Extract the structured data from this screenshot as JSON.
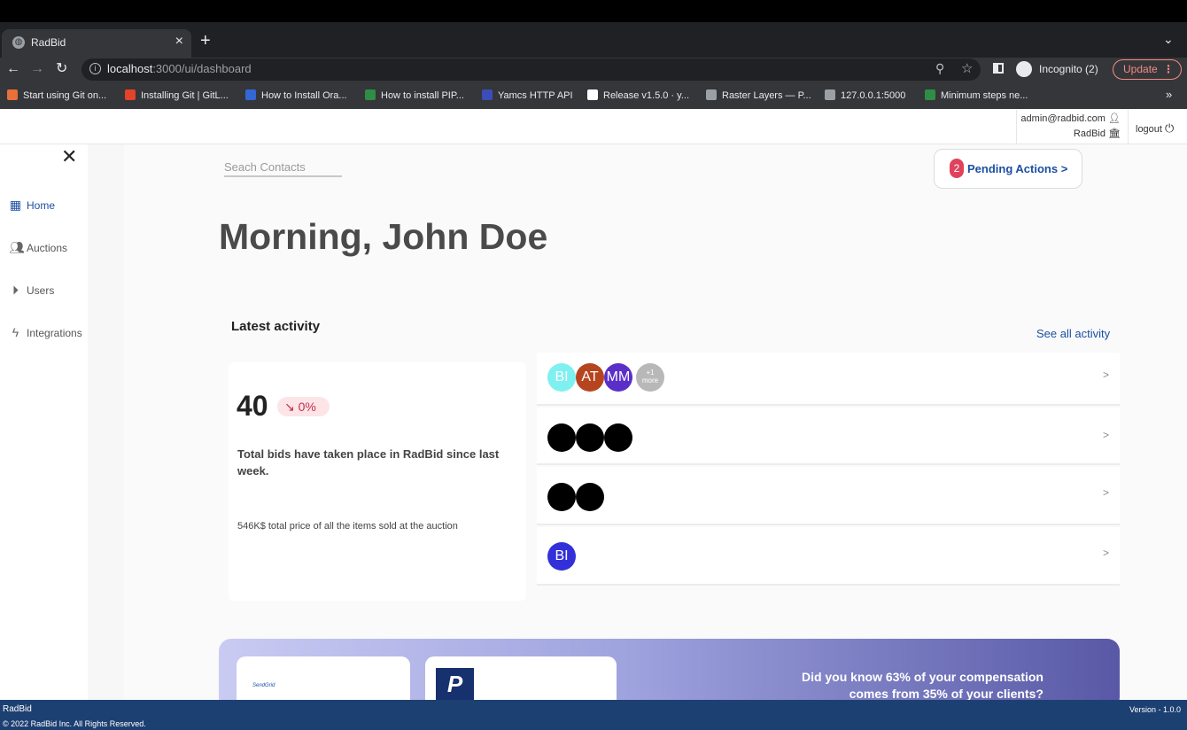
{
  "browser": {
    "tab_title": "RadBid",
    "url_host": "localhost",
    "url_path": ":3000/ui/dashboard",
    "profile_label": "Incognito (2)",
    "update_label": "Update",
    "bookmarks": [
      {
        "label": "Start using Git on...",
        "icon": "git-icon",
        "color": "#e8703a"
      },
      {
        "label": "Installing Git | GitL...",
        "icon": "gitlab-icon",
        "color": "#e24329"
      },
      {
        "label": "How to Install Ora...",
        "icon": "h-icon",
        "color": "#3367d6"
      },
      {
        "label": "How to install PIP...",
        "icon": "geeks-icon",
        "color": "#2f8d46"
      },
      {
        "label": "Yamcs HTTP API",
        "icon": "yamcs-icon",
        "color": "#3b4db8"
      },
      {
        "label": "Release v1.5.0 · y...",
        "icon": "github-icon",
        "color": "#ffffff"
      },
      {
        "label": "Raster Layers — P...",
        "icon": "globe-icon",
        "color": "#9aa0a6"
      },
      {
        "label": "127.0.0.1:5000",
        "icon": "window-icon",
        "color": "#9aa0a6"
      },
      {
        "label": "Minimum steps ne...",
        "icon": "geeks-icon",
        "color": "#2f8d46"
      }
    ]
  },
  "account": {
    "email": "admin@radbid.com",
    "org": "RadBid",
    "logout_label": "logout"
  },
  "sidebar": {
    "items": [
      {
        "label": "Home",
        "icon": "grid-icon"
      },
      {
        "label": "Auctions",
        "icon": "users-icon"
      },
      {
        "label": "Users",
        "icon": "play-circle-icon"
      },
      {
        "label": "Integrations",
        "icon": "bolt-icon"
      }
    ]
  },
  "search": {
    "placeholder": "Seach Contacts"
  },
  "pending": {
    "count": "2",
    "label": "Pending Actions >"
  },
  "greeting": "Morning, John Doe",
  "activity": {
    "title": "Latest activity",
    "see_all": "See all activity",
    "stat_value": "40",
    "stat_change": "0%",
    "stat_text": "Total bids have taken place in RadBid since last week.",
    "stat_sub": "546K$ total price of all the items sold at the auction",
    "row_arrow": ">",
    "rows": [
      {
        "avatars": [
          {
            "initials": "BI",
            "color": "#7ef0f0"
          },
          {
            "initials": "AT",
            "color": "#b5451f"
          },
          {
            "initials": "MM",
            "color": "#5a2fc9"
          }
        ],
        "more_count": "+1",
        "more_label": "more"
      },
      {
        "black_avatars": 3
      },
      {
        "black_avatars": 2
      },
      {
        "avatars": [
          {
            "initials": "BI",
            "color": "#3230d8"
          }
        ]
      }
    ]
  },
  "banner": {
    "sendgrid_label": "SendGrid",
    "paypal_label": "P",
    "text": "Did you know 63% of your compensation comes from 35% of your clients?"
  },
  "footer": {
    "brand": "RadBid",
    "copyright": "© 2022 RadBid Inc. All Rights Reserved.",
    "version": "Version - 1.0.0"
  }
}
